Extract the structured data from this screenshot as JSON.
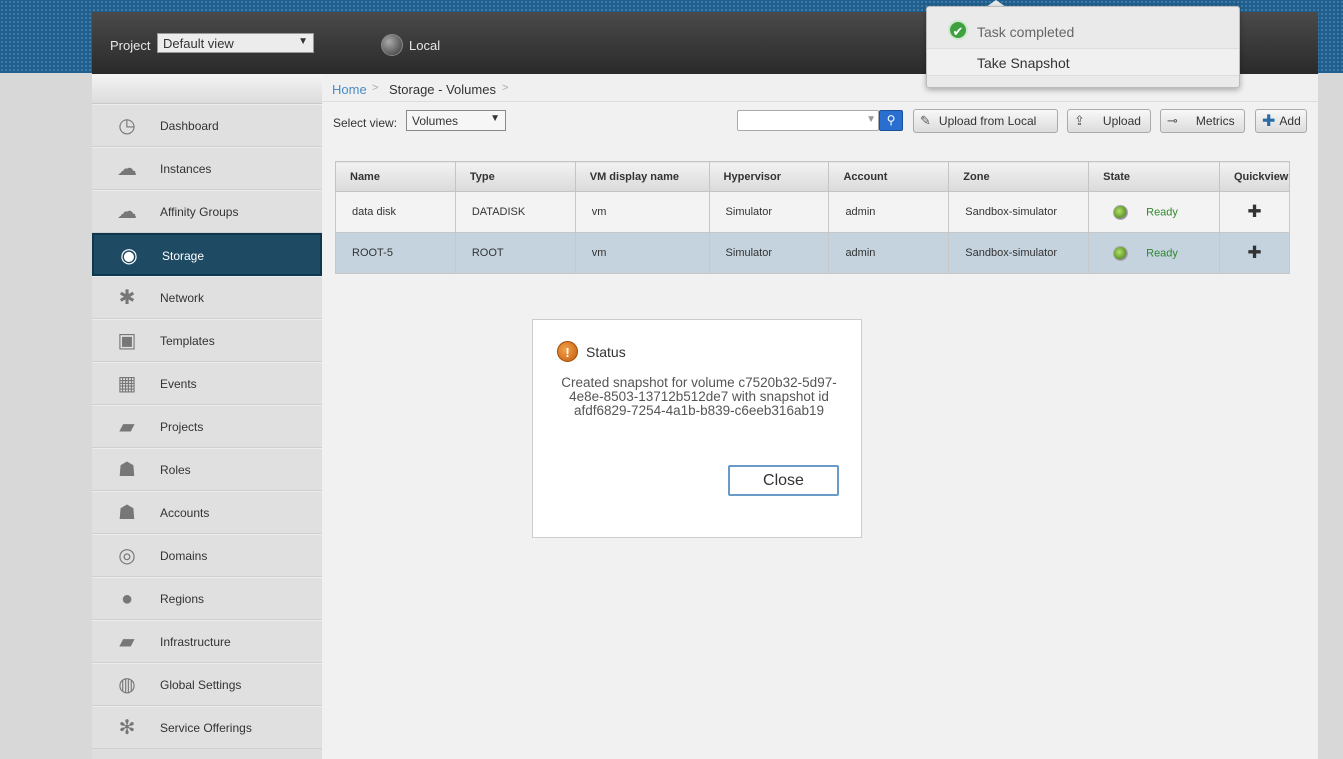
{
  "header": {
    "project_label": "Project",
    "project_value": "Default view",
    "zone_label": "Local"
  },
  "sidebar": {
    "items": [
      {
        "label": "Dashboard",
        "icon": "dashboard-icon",
        "glyph": "◷"
      },
      {
        "label": "Instances",
        "icon": "cloud-icon",
        "glyph": "☁"
      },
      {
        "label": "Affinity Groups",
        "icon": "affinity-groups-icon",
        "glyph": "☁"
      },
      {
        "label": "Storage",
        "icon": "storage-icon",
        "glyph": "◉",
        "active": true
      },
      {
        "label": "Network",
        "icon": "network-icon",
        "glyph": "✱"
      },
      {
        "label": "Templates",
        "icon": "templates-icon",
        "glyph": "▣"
      },
      {
        "label": "Events",
        "icon": "calendar-icon",
        "glyph": "▦"
      },
      {
        "label": "Projects",
        "icon": "folder-icon",
        "glyph": "▰"
      },
      {
        "label": "Roles",
        "icon": "users-icon",
        "glyph": "☗"
      },
      {
        "label": "Accounts",
        "icon": "user-icon",
        "glyph": "☗"
      },
      {
        "label": "Domains",
        "icon": "domains-icon",
        "glyph": "◎"
      },
      {
        "label": "Regions",
        "icon": "globe-icon",
        "glyph": "●"
      },
      {
        "label": "Infrastructure",
        "icon": "infrastructure-icon",
        "glyph": "▰"
      },
      {
        "label": "Global Settings",
        "icon": "global-settings-icon",
        "glyph": "◍"
      },
      {
        "label": "Service Offerings",
        "icon": "gear-icon",
        "glyph": "✻"
      }
    ]
  },
  "breadcrumb": {
    "home": "Home",
    "sep": ">",
    "current": "Storage - Volumes"
  },
  "toolbar": {
    "select_view_label": "Select view:",
    "select_view_value": "Volumes",
    "upload_local": "Upload from Local",
    "upload": "Upload",
    "metrics": "Metrics",
    "add": "Add"
  },
  "table": {
    "columns": [
      "Name",
      "Type",
      "VM display name",
      "Hypervisor",
      "Account",
      "Zone",
      "State",
      "Quickview"
    ],
    "rows": [
      {
        "name": "data disk",
        "type": "DATADISK",
        "vm": "vm",
        "hypervisor": "Simulator",
        "account": "admin",
        "zone": "Sandbox-simulator",
        "state": "Ready",
        "quickview": "✚"
      },
      {
        "name": "ROOT-5",
        "type": "ROOT",
        "vm": "vm",
        "hypervisor": "Simulator",
        "account": "admin",
        "zone": "Sandbox-simulator",
        "state": "Ready",
        "quickview": "✚"
      }
    ]
  },
  "notification": {
    "title": "Task completed",
    "task": "Take Snapshot"
  },
  "dialog": {
    "title": "Status",
    "message": "Created snapshot for volume c7520b32-5d97-4e8e-8503-13712b512de7 with snapshot id afdf6829-7254-4a1b-b839-c6eeb316ab19",
    "close_label": "Close"
  }
}
